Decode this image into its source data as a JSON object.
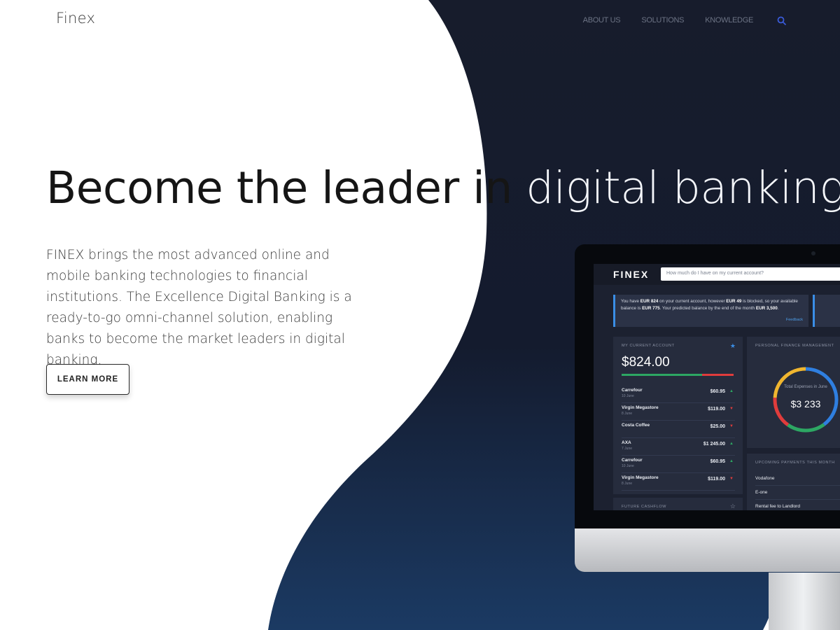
{
  "brand": {
    "logo": "Finex"
  },
  "nav": {
    "items": [
      "ABOUT US",
      "SOLUTIONS",
      "KNOWLEDGE"
    ]
  },
  "colors": {
    "dark_bg": "#141a2c",
    "nav_text": "#6c7384",
    "search_icon": "#3a5bd9",
    "accent_blue": "#3a8ee6"
  },
  "hero": {
    "headline_dark": "Become the leader in",
    "headline_light": "digital banking",
    "intro": "FINEX brings the most advanced online and mobile banking technologies to financial institutions. The Excellence Digital Banking is a ready-to-go omni-channel solution, enabling banks to become the market leaders in digital banking.",
    "cta": "LEARN MORE"
  },
  "app": {
    "logo": "FINEX",
    "search_placeholder": "How much do I have on my current account?",
    "notice": {
      "text_1": "You have ",
      "amount_1": "EUR 824",
      "text_2": " on your current account, however ",
      "amount_2": "EUR 49",
      "text_3": " is blocked, so your available balance is ",
      "amount_3": "EUR 775",
      "text_4": ". Your predicted balance by the end of the month ",
      "amount_4": "EUR 3,500",
      "text_5": ".",
      "link": "Feedback"
    },
    "account": {
      "title": "MY CURRENT ACCOUNT",
      "balance": "$824.00",
      "transactions": [
        {
          "name": "Carrefour",
          "date": "10 June",
          "amount": "$60.95",
          "dir": "up"
        },
        {
          "name": "Virgin Megastore",
          "date": "8 June",
          "amount": "$119.00",
          "dir": "down"
        },
        {
          "name": "Costa Coffee",
          "date": "",
          "amount": "$25.00",
          "dir": "down"
        },
        {
          "name": "AXA",
          "date": "7 June",
          "amount": "$1 245.00",
          "dir": "up"
        },
        {
          "name": "Carrefour",
          "date": "10 June",
          "amount": "$60.95",
          "dir": "up"
        },
        {
          "name": "Virgin Megastore",
          "date": "8 June",
          "amount": "$119.00",
          "dir": "down"
        }
      ]
    },
    "cashflow": {
      "title": "FUTURE CASHFLOW"
    },
    "pfm": {
      "title": "PERSONAL FINANCE MANAGEMENT",
      "label": "Total Expenses in June",
      "value": "$3 233"
    },
    "payments": {
      "title": "UPCOMING PAYMENTS THIS MONTH",
      "items": [
        "Vodafone",
        "E-one",
        "Rental fee to Landlord"
      ]
    }
  }
}
